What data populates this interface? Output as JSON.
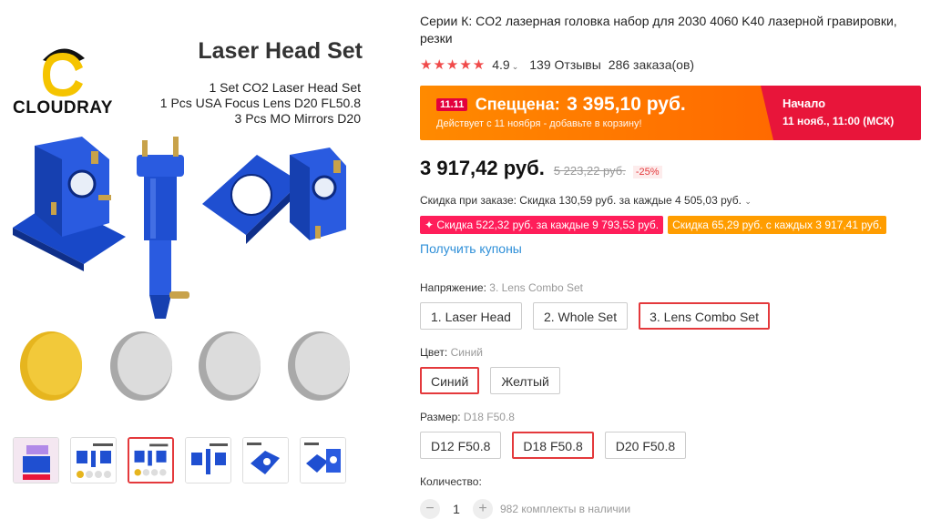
{
  "gallery": {
    "brand": "CLOUDRAY",
    "image_title": "Laser Head Set",
    "image_lines": [
      "1 Set  CO2 Laser Head Set",
      "1 Pcs  USA Focus Lens D20 FL50.8",
      "3 Pcs  MO Mirrors D20"
    ],
    "thumbnails": [
      "thumb-1",
      "thumb-2",
      "thumb-3",
      "thumb-4",
      "thumb-5",
      "thumb-6"
    ],
    "active_thumbnail_index": 2,
    "colors": {
      "metal": "#1f4fd1",
      "brass": "#c8a24a",
      "lens": "#e6b51e",
      "mirror": "#d7d7d7"
    }
  },
  "product": {
    "title": "Серии К: CO2 лазерная головка набор для 2030 4060 K40 лазерной гравировки, резки",
    "rating": "4.9",
    "stars": "★★★★★",
    "reviews": "139 Отзывы",
    "orders": "286 заказа(ов)"
  },
  "promo": {
    "tag": "11.11",
    "label": "Спеццена:",
    "price": "3 395,10 руб.",
    "note": "Действует с 11 ноября - добавьте в корзину!",
    "start_label": "Начало",
    "start_date": "11 нояб., 11:00 (МСК)",
    "colors": {
      "left": "#ff7a00",
      "right": "#e8153a"
    }
  },
  "pricing": {
    "price": "3 917,42 руб.",
    "old_price": "5 223,22 руб.",
    "discount": "-25%",
    "order_discount": "Скидка при заказе: Скидка 130,59 руб. за каждые 4 505,03 руб.",
    "coupons": [
      {
        "text": "✦ Скидка 522,32 руб. за каждые 9 793,53 руб."
      },
      {
        "text": "Скидка 65,29 руб. с каждых 3 917,41 руб."
      }
    ],
    "get_coupons": "Получить купоны"
  },
  "options": {
    "voltage": {
      "label": "Напряжение:",
      "selected": "3. Lens Combo Set",
      "values": [
        "1. Laser Head",
        "2. Whole Set",
        "3. Lens Combo Set"
      ]
    },
    "color": {
      "label": "Цвет:",
      "selected": "Синий",
      "values": [
        "Синий",
        "Желтый"
      ]
    },
    "size": {
      "label": "Размер:",
      "selected": "D18 F50.8",
      "values": [
        "D12 F50.8",
        "D18 F50.8",
        "D20 F50.8"
      ]
    }
  },
  "quantity": {
    "label": "Количество:",
    "value": "1",
    "minus": "−",
    "plus": "+",
    "stock": "982 комплекты в наличии"
  }
}
